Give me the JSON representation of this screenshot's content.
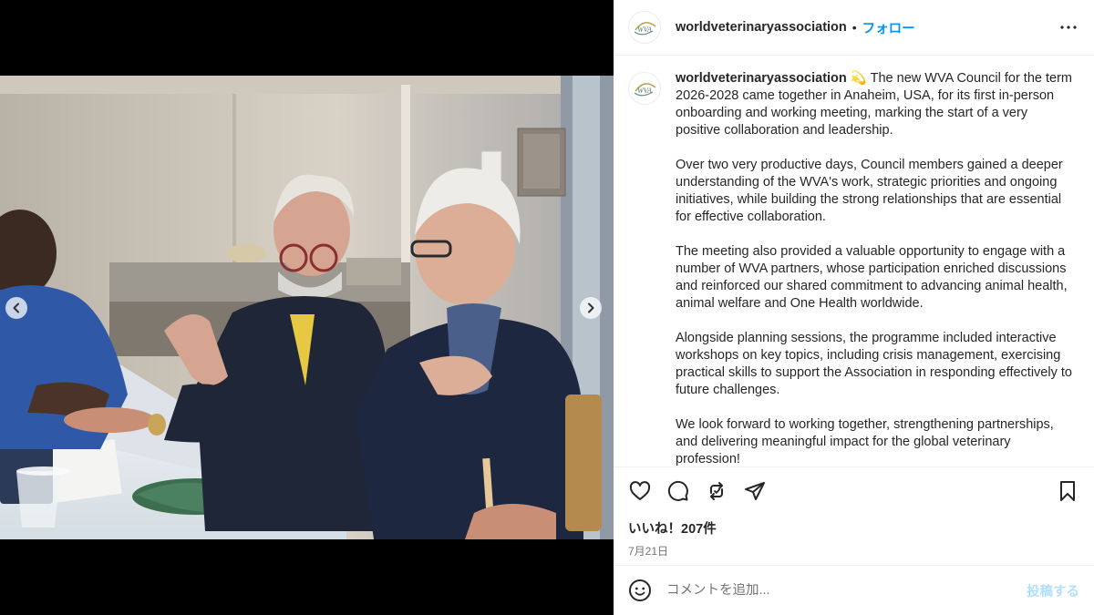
{
  "post": {
    "username": "worldveterinaryassociation",
    "follow_separator": "•",
    "follow_label": "フォロー",
    "more_icon": "more-horizontal-icon"
  },
  "media": {
    "photo_alt": "Council meeting photo",
    "prev_icon": "chevron-left-icon",
    "next_icon": "chevron-right-icon"
  },
  "caption": {
    "username": "worldveterinaryassociation",
    "emoji": "💫",
    "paragraphs": [
      "The new WVA Council for the term 2026-2028 came together in Anaheim, USA, for its first in-person onboarding and working meeting, marking the start of a very positive collaboration and leadership.",
      "Over two very productive days, Council members gained a deeper understanding of the WVA's work, strategic priorities and ongoing initiatives, while building the strong relationships that are essential for effective collaboration.",
      "The meeting also provided a valuable opportunity to engage with a number of WVA partners, whose participation enriched discussions and reinforced our shared commitment to advancing animal health, animal welfare and One Health worldwide.",
      "Alongside planning sessions, the programme included interactive workshops on key topics, including crisis management, exercising practical skills to support the Association in responding effectively to future challenges.",
      "We look forward to working together, strengthening partnerships, and delivering meaningful impact for the global veterinary profession!"
    ]
  },
  "actions": {
    "like_icon": "heart-icon",
    "comment_icon": "comment-icon",
    "repost_icon": "repost-icon",
    "share_icon": "share-icon",
    "save_icon": "bookmark-icon"
  },
  "stats": {
    "likes": "いいね！207件",
    "date": "7月21日"
  },
  "comment_box": {
    "placeholder": "コメントを追加...",
    "post_label": "投稿する",
    "emoji_icon": "smiley-icon"
  },
  "colors": {
    "accent": "#0095f6",
    "post_disabled": "#b2dffc",
    "text": "#262626",
    "muted": "#737373"
  }
}
